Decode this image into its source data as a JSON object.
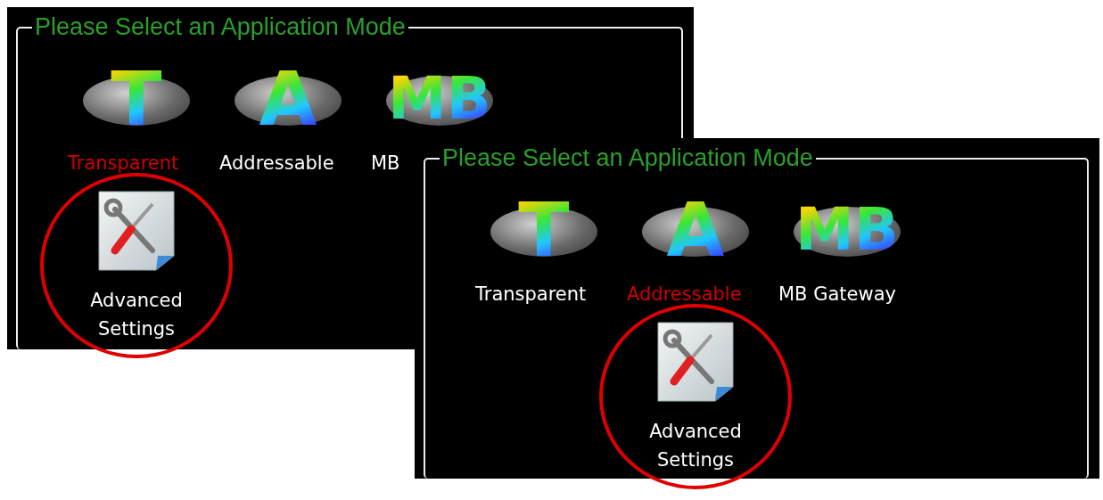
{
  "panels": [
    {
      "legend": "Please Select an Application Mode",
      "rows": [
        [
          {
            "kind": "logo",
            "logo": "T",
            "label": "Transparent",
            "selected": true,
            "highlighted": false
          },
          {
            "kind": "logo",
            "logo": "A",
            "label": "Addressable",
            "selected": false,
            "highlighted": false
          },
          {
            "kind": "logo",
            "logo": "MB",
            "label": "MB",
            "selected": false,
            "highlighted": false
          }
        ],
        [
          {
            "kind": "settings",
            "label": "Advanced Settings",
            "selected": false,
            "highlighted": true
          }
        ]
      ]
    },
    {
      "legend": "Please Select an Application Mode",
      "rows": [
        [
          {
            "kind": "logo",
            "logo": "T",
            "label": "Transparent",
            "selected": false,
            "highlighted": false
          },
          {
            "kind": "logo",
            "logo": "A",
            "label": "Addressable",
            "selected": true,
            "highlighted": false
          },
          {
            "kind": "logo",
            "logo": "MB",
            "label": "MB Gateway",
            "selected": false,
            "highlighted": false
          }
        ],
        [
          null,
          {
            "kind": "settings",
            "label": "Advanced Settings",
            "selected": false,
            "highlighted": true
          }
        ]
      ]
    }
  ]
}
